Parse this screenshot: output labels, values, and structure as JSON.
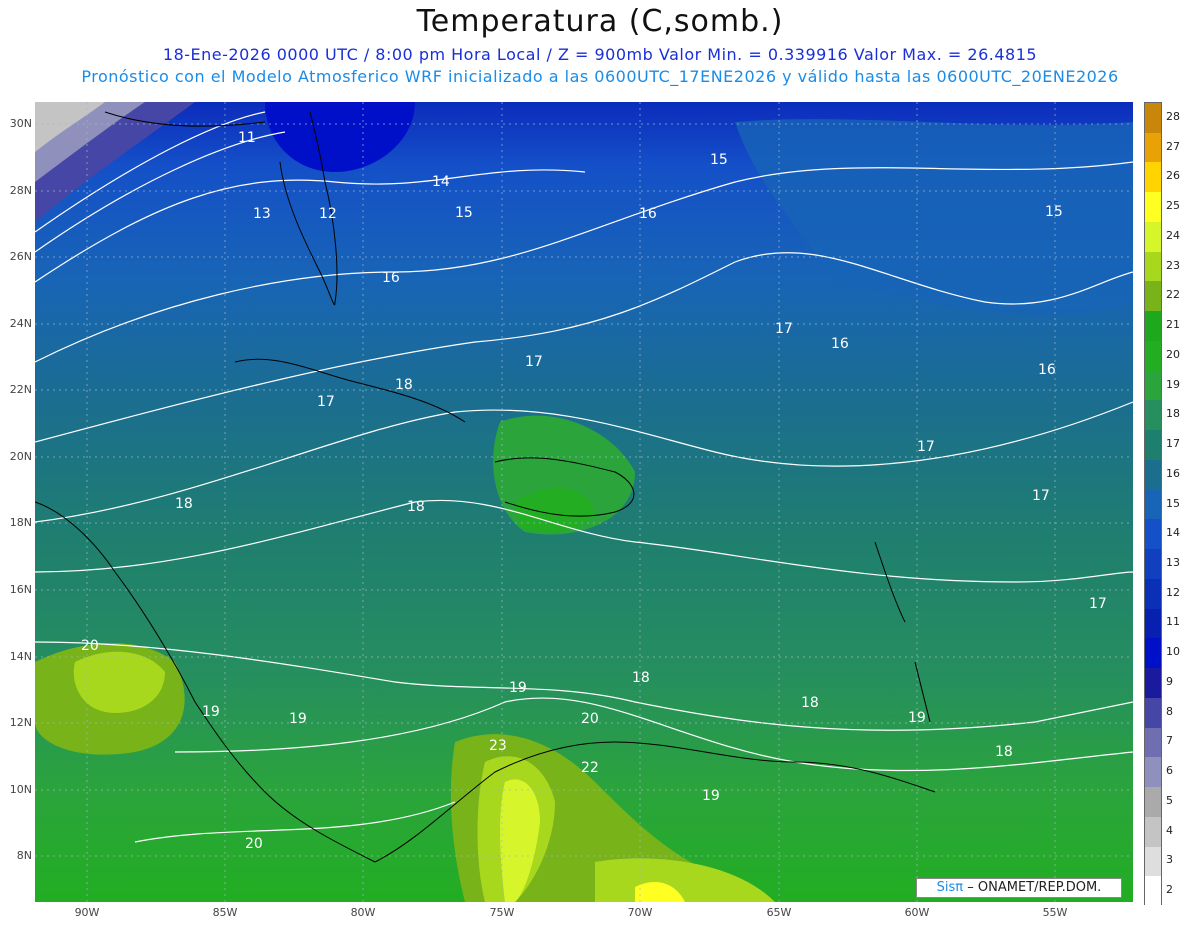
{
  "header": {
    "title": "Temperatura (C,somb.)",
    "line1": "18-Ene-2026  0000 UTC / 8:00 pm Hora Local / Z = 900mb   Valor Min. = 0.339916  Valor Max. = 26.4815",
    "line2": "Pronóstico con el Modelo Atmosferico WRF inicializado a las 0600UTC_17ENE2026 y válido hasta las  0600UTC_20ENE2026"
  },
  "map": {
    "lat_labels": [
      "30N",
      "28N",
      "26N",
      "24N",
      "22N",
      "20N",
      "18N",
      "16N",
      "14N",
      "12N",
      "10N",
      "8N"
    ],
    "lon_labels": [
      "90W",
      "85W",
      "80W",
      "75W",
      "70W",
      "65W",
      "60W",
      "55W"
    ],
    "contour_labels": [
      "11",
      "12",
      "13",
      "14",
      "15",
      "15",
      "15",
      "16",
      "16",
      "16",
      "16",
      "17",
      "17",
      "17",
      "17",
      "17",
      "17",
      "18",
      "18",
      "18",
      "18",
      "18",
      "18",
      "19",
      "19",
      "19",
      "19",
      "19",
      "20",
      "20",
      "20",
      "22",
      "23"
    ],
    "credit_logo": "Sisπ",
    "credit_text": "– ONAMET/REP.DOM."
  },
  "colorbar": {
    "levels": [
      "28",
      "27",
      "26",
      "25",
      "24",
      "23",
      "22",
      "21",
      "20",
      "19",
      "18",
      "17",
      "16",
      "15",
      "14",
      "13",
      "12",
      "11",
      "10",
      "9",
      "8",
      "7",
      "6",
      "5",
      "4",
      "3",
      "2"
    ],
    "colors": [
      "#c8860a",
      "#e8a208",
      "#ffd400",
      "#ffff22",
      "#d6f52a",
      "#a8d81e",
      "#78b31a",
      "#1ea81e",
      "#22ad22",
      "#2ba43c",
      "#268f5e",
      "#1f7f6e",
      "#1b6e8e",
      "#1864b6",
      "#1450c8",
      "#1040c0",
      "#0b30b8",
      "#0820b0",
      "#0010c8",
      "#1a1a9e",
      "#4646a6",
      "#6e6eb0",
      "#9090bc",
      "#aaaaaa",
      "#c4c4c4",
      "#dedede",
      "#ffffff"
    ]
  }
}
